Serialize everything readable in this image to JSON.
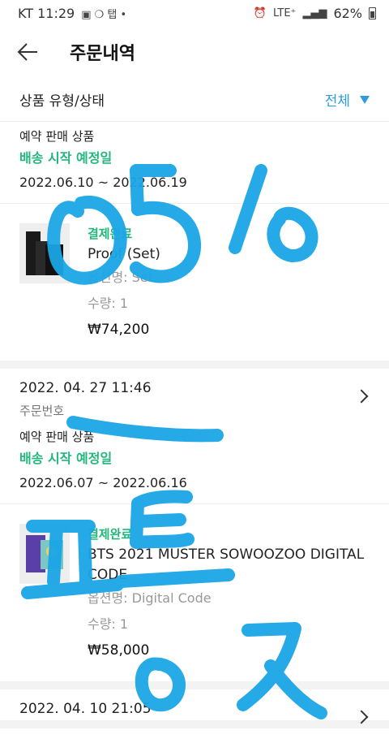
{
  "status_bar": {
    "carrier_time": "KT 11:29",
    "notification_icons": "▣ ❍ 탭 •",
    "network": "LTE⁺",
    "battery": "62%"
  },
  "app_bar": {
    "title": "주문내역"
  },
  "filter": {
    "label": "상품 유형/상태",
    "value": "전체"
  },
  "orders": [
    {
      "date": "",
      "order_number": "",
      "sale_type": "예약 판매 상품",
      "ship_label": "배송 시작 예정일",
      "ship_range": "2022.06.10 ~ 2022.06.19",
      "product": {
        "status": "결제완료",
        "name": "Proof (Set)",
        "option": "옵션명: Set",
        "quantity": "수량: 1",
        "price": "₩74,200"
      }
    },
    {
      "date": "2022. 04. 27 11:46",
      "order_number": "주문번호",
      "sale_type": "예약 판매 상품",
      "ship_label": "배송 시작 예정일",
      "ship_range": "2022.06.07 ~ 2022.06.16",
      "product": {
        "status": "결제완료",
        "name": "BTS 2021 MUSTER SOWOOZOO DIGITAL CODE",
        "option": "옵션명: Digital Code",
        "quantity": "수량: 1",
        "price": "₩58,000"
      }
    },
    {
      "date": "2022. 04. 10 21:05"
    }
  ],
  "colors": {
    "accent_blue": "#2f9cdd",
    "status_green": "#23b67d",
    "scribble_blue": "#1aa6e6"
  },
  "icons": {
    "back": "arrow-left-icon",
    "filter": "triangle-down-icon",
    "chevron": "chevron-right-icon"
  }
}
